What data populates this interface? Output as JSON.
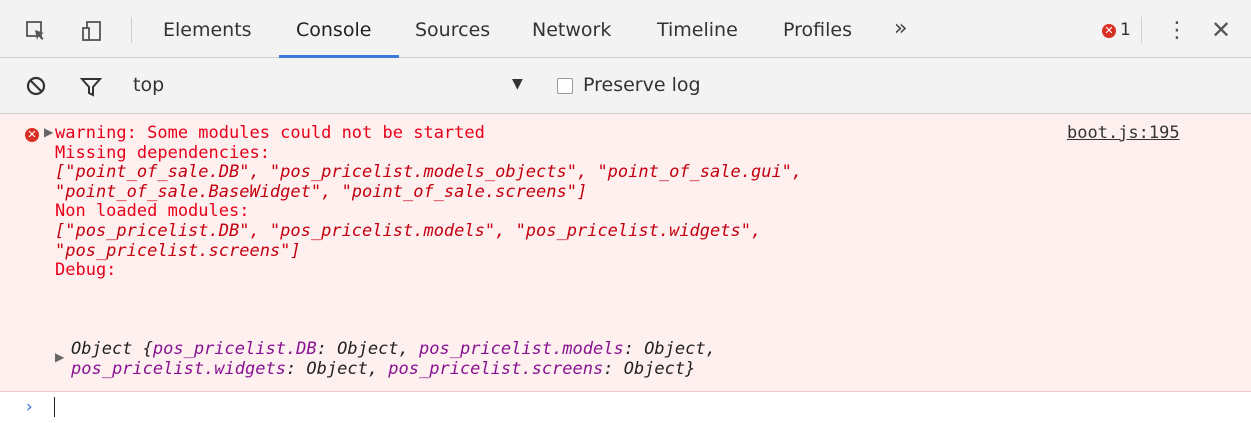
{
  "tabbar": {
    "tabs": [
      {
        "label": "Elements"
      },
      {
        "label": "Console"
      },
      {
        "label": "Sources"
      },
      {
        "label": "Network"
      },
      {
        "label": "Timeline"
      },
      {
        "label": "Profiles"
      }
    ],
    "more_label": "»",
    "error_count": "1",
    "active_tab": "Console",
    "accent_color": "#3879d9"
  },
  "toolbar": {
    "context": "top",
    "context_arrow": "▼",
    "preserve_log": "Preserve log",
    "preserve_checked": false
  },
  "message": {
    "level": "error",
    "line1": "warning: Some modules could not be started",
    "line2": "Missing dependencies:",
    "line3": "[\"point_of_sale.DB\", \"pos_pricelist.models_objects\", \"point_of_sale.gui\",",
    "line4": "\"point_of_sale.BaseWidget\", \"point_of_sale.screens\"]",
    "line5": "Non loaded modules:",
    "line6": "[\"pos_pricelist.DB\", \"pos_pricelist.models\", \"pos_pricelist.widgets\",",
    "line7": "\"pos_pricelist.screens\"]",
    "line8": "Debug:",
    "source": "boot.js:195",
    "object": {
      "prefix": "Object {",
      "k1": "pos_pricelist.DB",
      "v1": ": Object, ",
      "k2": "pos_pricelist.models",
      "v2": ": Object,",
      "k3": "pos_pricelist.widgets",
      "v3": ": Object, ",
      "k4": "pos_pricelist.screens",
      "v4": ": Object}"
    },
    "error_color": "#e8001a",
    "background_color": "#fff0f0"
  },
  "prompt": {
    "symbol": "›"
  }
}
